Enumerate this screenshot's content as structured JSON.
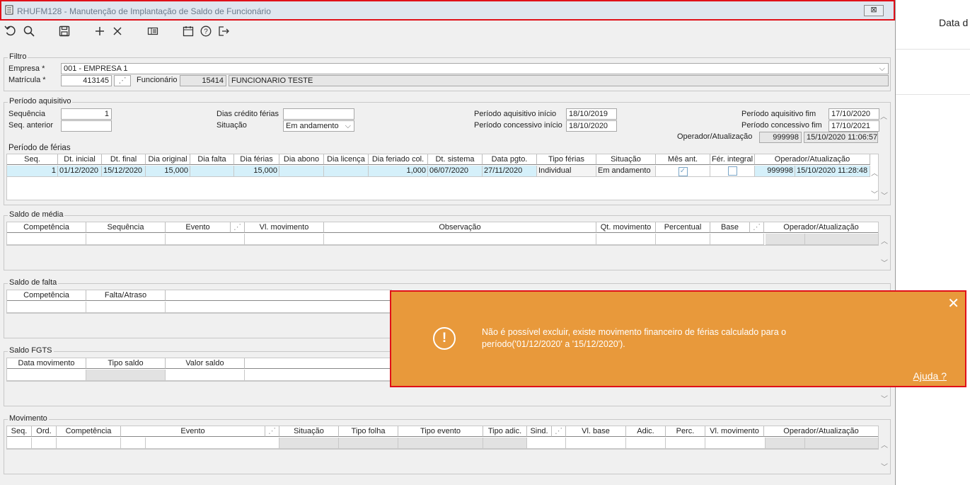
{
  "window": {
    "title": "RHUFM128 - Manutenção de Implantação de Saldo de Funcionário",
    "close_label": "⊠"
  },
  "side": {
    "label": "Data d"
  },
  "toolbar": {
    "icons": [
      "undo-icon",
      "search-icon",
      "save-icon",
      "add-icon",
      "delete-icon",
      "list-icon",
      "calendar-icon",
      "help-icon",
      "exit-icon"
    ]
  },
  "filtro": {
    "legend": "Filtro",
    "empresa_label": "Empresa *",
    "empresa_value": "001 - EMPRESA 1",
    "matricula_label": "Matrícula *",
    "matricula_value": "413145",
    "funcionario_label": "Funcionário",
    "funcionario_code": "15414",
    "funcionario_name": "FUNCIONARIO TESTE"
  },
  "aquisitivo": {
    "legend": "Período aquisitivo",
    "sequencia_label": "Sequência",
    "sequencia_value": "1",
    "seq_anterior_label": "Seq. anterior",
    "seq_anterior_value": "",
    "dias_credito_label": "Dias crédito férias",
    "dias_credito_value": "",
    "situacao_label": "Situação",
    "situacao_value": "Em andamento",
    "pa_inicio_label": "Período aquisitivo início",
    "pa_inicio_value": "18/10/2019",
    "pc_inicio_label": "Período concessivo início",
    "pc_inicio_value": "18/10/2020",
    "pa_fim_label": "Período aquisitivo fim",
    "pa_fim_value": "17/10/2020",
    "pc_fim_label": "Período concessivo fim",
    "pc_fim_value": "17/10/2021",
    "operador_label": "Operador/Atualização",
    "operador_code": "999998",
    "operador_date": "15/10/2020 11:06:57"
  },
  "ferias": {
    "legend": "Período de férias",
    "headers": [
      "Seq.",
      "Dt. inicial",
      "Dt. final",
      "Dia original",
      "Dia falta",
      "Dia férias",
      "Dia abono",
      "Dia licença",
      "Dia feriado col.",
      "Dt. sistema",
      "Data pgto.",
      "Tipo férias",
      "Situação",
      "Mês ant.",
      "Fér. integral",
      "Operador/Atualização"
    ],
    "row": {
      "seq": "1",
      "dt_inicial": "01/12/2020",
      "dt_final": "15/12/2020",
      "dia_original": "15,000",
      "dia_falta": "",
      "dia_ferias": "15,000",
      "dia_abono": "",
      "dia_licenca": "",
      "dia_feriado": "1,000",
      "dt_sistema": "06/07/2020",
      "data_pgto": "27/11/2020",
      "tipo_ferias": "Individual",
      "situacao": "Em andamento",
      "mes_ant": true,
      "fer_integral": false,
      "operador_code": "999998",
      "operador_date": "15/10/2020 11:28:48"
    }
  },
  "media": {
    "legend": "Saldo de média",
    "headers": [
      "Competência",
      "Sequência",
      "Evento",
      "",
      "Vl. movimento",
      "Observação",
      "Qt. movimento",
      "Percentual",
      "Base",
      "",
      "Operador/Atualização"
    ]
  },
  "falta": {
    "legend": "Saldo de falta",
    "headers": [
      "Competência",
      "Falta/Atraso"
    ]
  },
  "fgts": {
    "legend": "Saldo FGTS",
    "headers": [
      "Data movimento",
      "Tipo saldo",
      "Valor saldo"
    ]
  },
  "movimento": {
    "legend": "Movimento",
    "headers": [
      "Seq.",
      "Ord.",
      "Competência",
      "Evento",
      "",
      "Situação",
      "Tipo folha",
      "Tipo evento",
      "Tipo adic.",
      "Sind.",
      "",
      "Vl. base",
      "Adic.",
      "Perc.",
      "Vl. movimento",
      "Operador/Atualização"
    ]
  },
  "toast": {
    "message": "Não é possível excluir, existe movimento financeiro de férias calculado para o período('01/12/2020' a '15/12/2020').",
    "link": "Ajuda ?",
    "close": "✕",
    "icon": "!"
  },
  "colors": {
    "toast": "#e8993b",
    "highlight": "#e0101a",
    "selected_row": "#d5f0fa"
  }
}
